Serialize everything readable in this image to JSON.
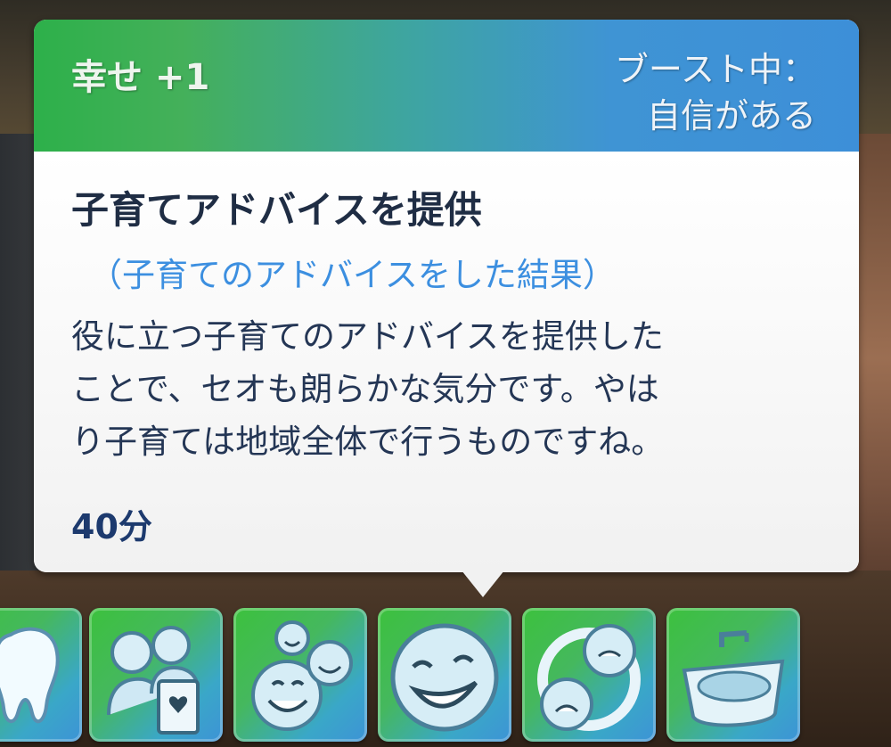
{
  "tooltip": {
    "happiness": "幸せ +1",
    "boost_label": "ブースト中：",
    "boost_value": "自信がある",
    "title": "子育てアドバイスを提供",
    "subtitle": "（子育てのアドバイスをした結果）",
    "description_lines": [
      "役に立つ子育てのアドバイスを提供した",
      "ことで、セオも朗らかな気分です。やは",
      "り子育ては地域全体で行うものですね。"
    ],
    "duration": "40分"
  },
  "moodlets": [
    {
      "icon": "tooth-icon"
    },
    {
      "icon": "family-card-icon"
    },
    {
      "icon": "happy-bubbles-icon"
    },
    {
      "icon": "big-smile-icon"
    },
    {
      "icon": "mixed-emotion-icon"
    },
    {
      "icon": "sink-icon"
    }
  ],
  "colors": {
    "header_green": "#2db04a",
    "header_blue": "#3d8fd8",
    "title": "#1f2d44",
    "subtitle": "#3c8fe0",
    "body_text": "#243655"
  }
}
